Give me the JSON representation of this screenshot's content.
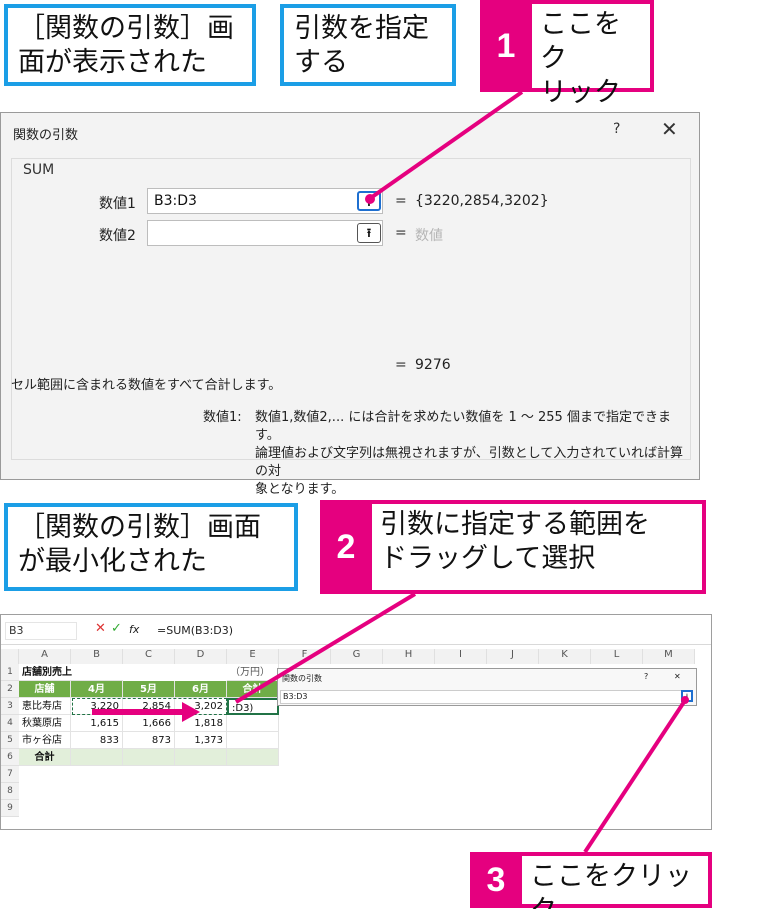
{
  "callouts": {
    "top_left": "［関数の引数］画\n面が表示された",
    "top_mid": "引数を指定\nする",
    "bottom_left": "［関数の引数］画面\nが最小化された"
  },
  "steps": {
    "s1": {
      "num": "1",
      "text": "ここをク\nリック"
    },
    "s2": {
      "num": "2",
      "text": "引数に指定する範囲を\nドラッグして選択"
    },
    "s3": {
      "num": "3",
      "text": "ここをクリック"
    }
  },
  "dialog": {
    "title": "関数の引数",
    "help": "?",
    "close": "✕",
    "function": "SUM",
    "arg1_label": "数値1",
    "arg1_value": "B3:D3",
    "arg1_result": "{3220,2854,3202}",
    "arg2_label": "数値2",
    "arg2_value": "",
    "arg2_result": "数値",
    "eq": "=",
    "result": "9276",
    "description": "セル範囲に含まれる数値をすべて合計します。",
    "help_label": "数値1:",
    "help_text": "数値1,数値2,... には合計を求めたい数値を 1 ～ 255 個まで指定できます。\n論理値および文字列は無視されますが、引数として入力されていれば計算の対\n象となります。"
  },
  "excel": {
    "name_box": "B3",
    "fx": "fx",
    "formula": "=SUM(B3:D3)",
    "columns": [
      "A",
      "B",
      "C",
      "D",
      "E",
      "F",
      "G",
      "H",
      "I",
      "J",
      "K",
      "L",
      "M"
    ],
    "rows": [
      "1",
      "2",
      "3",
      "4",
      "5",
      "6",
      "7",
      "8",
      "9"
    ],
    "a1": "店舗別売上",
    "e1": "（万円）",
    "headers": [
      "店舗",
      "4月",
      "5月",
      "6月",
      "合計"
    ],
    "data": [
      {
        "store": "恵比寿店",
        "apr": "3,220",
        "may": "2,854",
        "jun": "3,202",
        "total": ":D3)"
      },
      {
        "store": "秋葉原店",
        "apr": "1,615",
        "may": "1,666",
        "jun": "1,818",
        "total": ""
      },
      {
        "store": "市ヶ谷店",
        "apr": "833",
        "may": "873",
        "jun": "1,373",
        "total": ""
      }
    ],
    "total_label": "合計",
    "mini_dialog": {
      "title": "関数の引数",
      "help": "?",
      "close": "✕",
      "value": "B3:D3"
    }
  },
  "colors": {
    "accent": "#e5007f",
    "callout_border": "#1b9ee6",
    "header_green": "#70ad47",
    "light_green": "#e2efda"
  }
}
